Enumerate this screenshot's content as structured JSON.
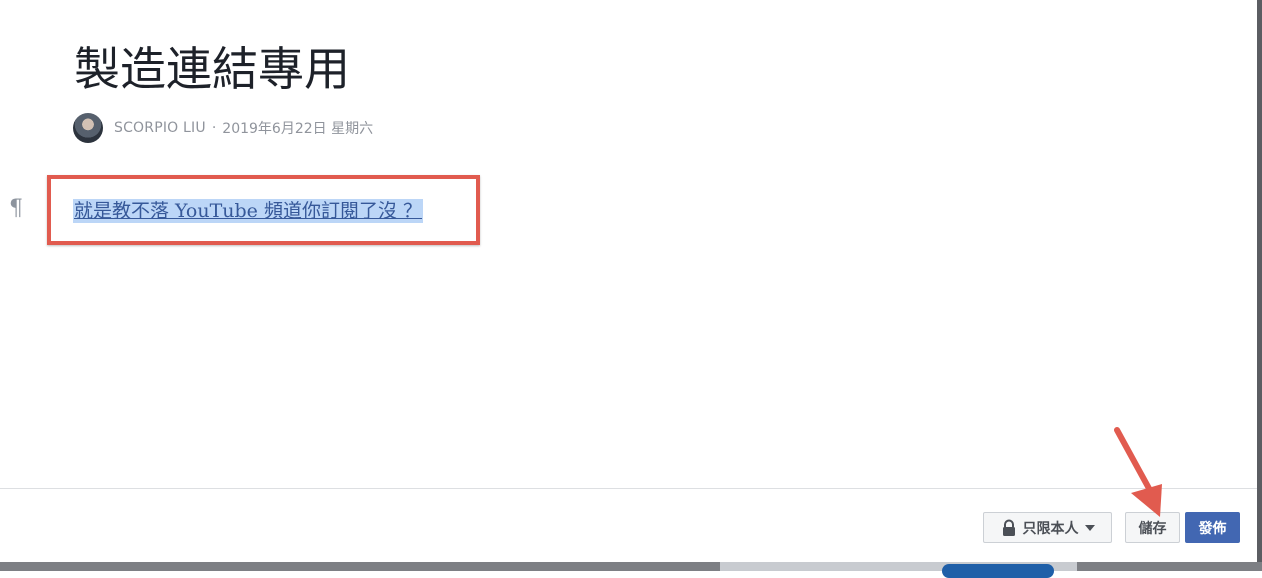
{
  "post": {
    "title": "製造連結專用",
    "author": "SCORPIO LIU",
    "separator": "·",
    "date": "2019年6月22日 星期六",
    "paragraph_mark": "¶",
    "link_text": "就是教不落 YouTube 頻道你訂閱了沒 ？"
  },
  "footer": {
    "privacy_label": "只限本人",
    "save_label": "儲存",
    "publish_label": "發佈"
  },
  "icons": {
    "avatar": "avatar",
    "lock": "lock-icon",
    "caret": "caret-down-icon",
    "arrow": "annotation-arrow-icon"
  },
  "colors": {
    "link": "#365899",
    "selection": "#bcd6f7",
    "annotation": "#e15b4f",
    "publish_button": "#4267b2"
  }
}
